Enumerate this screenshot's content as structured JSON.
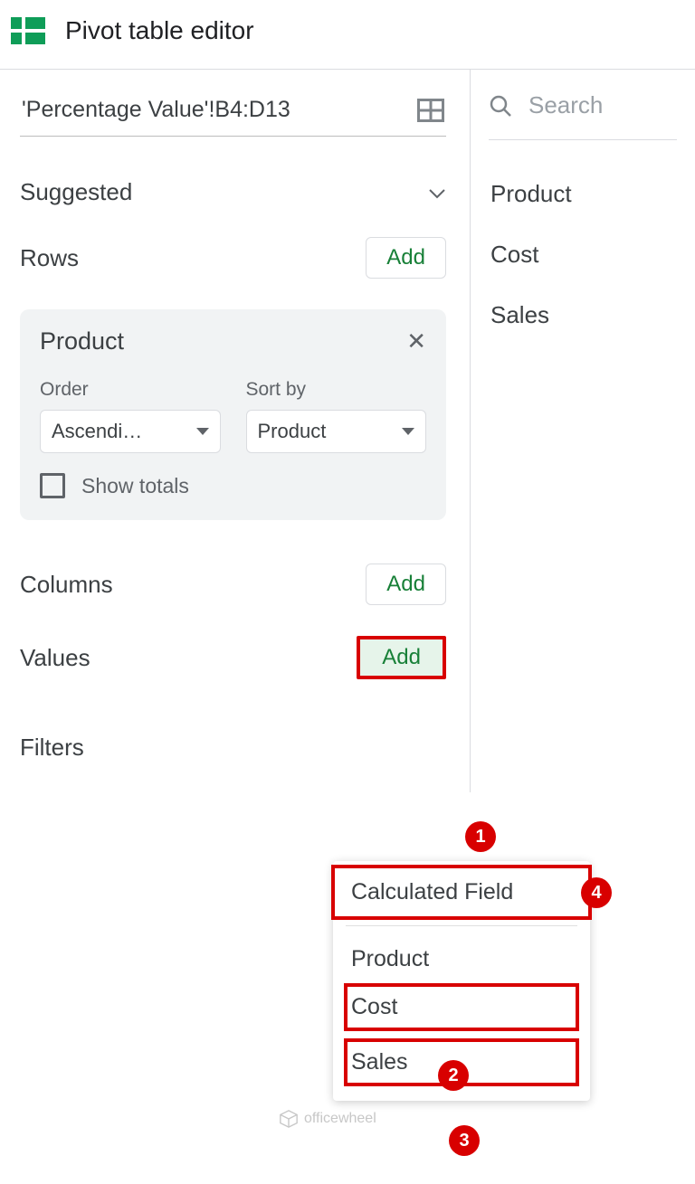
{
  "header": {
    "title": "Pivot table editor"
  },
  "range": "'Percentage Value'!B4:D13",
  "suggested_label": "Suggested",
  "add_label": "Add",
  "sections": {
    "rows": "Rows",
    "columns": "Columns",
    "values": "Values",
    "filters": "Filters"
  },
  "row_card": {
    "title": "Product",
    "order_label": "Order",
    "order_value": "Ascendi…",
    "sortby_label": "Sort by",
    "sortby_value": "Product",
    "show_totals": "Show totals"
  },
  "search_placeholder": "Search",
  "fields": [
    "Product",
    "Cost",
    "Sales"
  ],
  "popover": {
    "calculated": "Calculated Field",
    "items": [
      "Product",
      "Cost",
      "Sales"
    ]
  },
  "badges": {
    "b1": "1",
    "b2": "2",
    "b3": "3",
    "b4": "4"
  },
  "watermark": "officewheel"
}
